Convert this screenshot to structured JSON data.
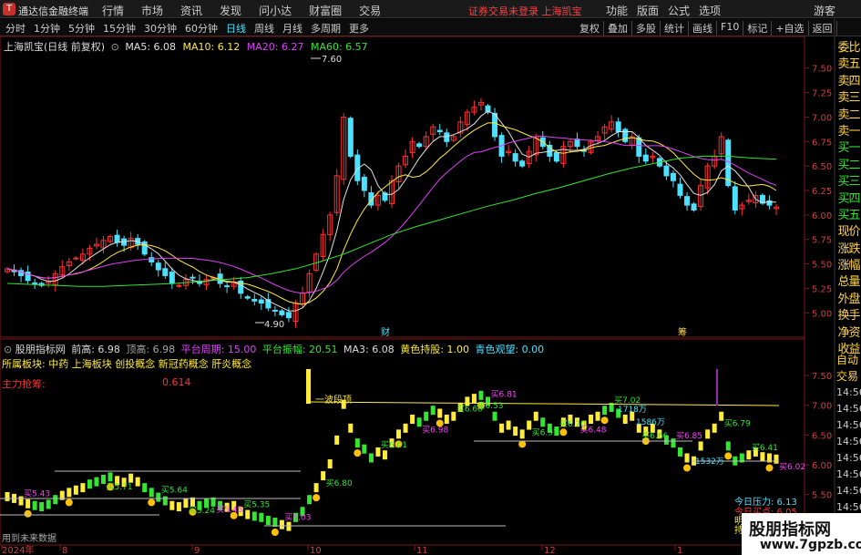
{
  "titlebar": {
    "app_name": "通达信金融终端",
    "menu": [
      "行情",
      "市场",
      "资讯",
      "发现",
      "问小达",
      "财富圈",
      "交易"
    ],
    "notice": "证券交易未登录  上海凯宝",
    "right_menu": [
      "功能",
      "版面",
      "公式",
      "选项"
    ],
    "guest": "游客"
  },
  "toolbar": {
    "periods": [
      "分时",
      "1分钟",
      "5分钟",
      "15分钟",
      "30分钟",
      "60分钟",
      "日线",
      "周线",
      "月线",
      "多周期",
      "更多"
    ],
    "active_period": "日线",
    "tools": [
      "复权",
      "叠加",
      "多股",
      "统计",
      "画线",
      "F10",
      "标记",
      "+自选",
      "返回"
    ]
  },
  "main_header": {
    "stock": "上海凯宝(日线 前复权)",
    "ma5_label": "MA5: 6.08",
    "ma10_label": "MA10: 6.12",
    "ma20_label": "MA20: 6.27",
    "ma60_label": "MA60: 6.57"
  },
  "sub_header": {
    "indicator": "股朋指标网",
    "prev_high": "前高: 6.98",
    "top_high": "顶高: 6.98",
    "cycle": "平台周期: 15.00",
    "amplitude": "平台振幅: 20.51",
    "ma3": "MA3: 6.08",
    "yellow_hold": "黄色持股: 1.00",
    "cyan_watch": "青色观望: 0.00"
  },
  "sectors": "所属板块: 中药 上海板块 创投概念 新冠药概念 肝炎概念",
  "main_force": {
    "label": "主力抢筹:",
    "value": "0.614"
  },
  "sidebar": {
    "items": [
      "委比",
      "卖五",
      "卖四",
      "卖三",
      "卖二",
      "卖一",
      "买一",
      "买二",
      "买三",
      "买四",
      "买五",
      "现价",
      "涨跌",
      "涨幅",
      "总量",
      "外盘",
      "换手",
      "净资",
      "收益"
    ],
    "bottom": [
      "自动",
      "交易",
      "14:56",
      "14:56",
      "14:56",
      "14:56",
      "14:56",
      "14:56",
      "14:56",
      "14:56",
      "14:56",
      "14:56"
    ]
  },
  "main_axis": [
    "7.50",
    "7.25",
    "7.00",
    "6.75",
    "6.50",
    "6.25",
    "6.00",
    "5.75",
    "5.50",
    "5.25",
    "5.00"
  ],
  "sub_axis": [
    "7.50",
    "7.00",
    "6.50",
    "6.00",
    "5.50"
  ],
  "date_axis": [
    "2024年",
    "8",
    "9",
    "10",
    "11",
    "12",
    "1"
  ],
  "chart_markers": {
    "high": "7.60",
    "low": "4.90",
    "cai": "财",
    "chou": "筹"
  },
  "sub_annotations": {
    "wave_top": "一波段顶",
    "today_pressure": "今日压力: 6.13",
    "today_buy": "今日买点: 6.05",
    "tomorrow": "明日",
    "hold": "持仓",
    "future_data": "用到未来数据",
    "buy_labels": [
      "买5.43",
      "买5.71",
      "买5.64",
      "买5.45",
      "买5.35",
      "买5.24",
      "买5.03",
      "买6.80",
      "买6.01",
      "买6.98",
      "买6.60",
      "买6.53",
      "买6.81",
      "买6.97",
      "买6.70",
      "买6.48",
      "买7.02",
      "买6.66",
      "买6.85",
      "买6.79",
      "买6.41",
      "买6.02"
    ],
    "vol_labels": [
      "1718万",
      "1532万",
      "1586万"
    ]
  },
  "watermark": {
    "line1": "股朋指标网",
    "line2": "www.7gpzb.com"
  },
  "chart_data": {
    "type": "candlestick",
    "ylim": [
      4.85,
      7.65
    ],
    "high_marker": 7.6,
    "low_marker": 4.9,
    "ma_latest": {
      "MA5": 6.08,
      "MA10": 6.12,
      "MA20": 6.27,
      "MA60": 6.57
    },
    "colors": {
      "up": "#ff3030",
      "down": "#4ee0ff",
      "ma5": "#e0e0e0",
      "ma10": "#ffeb3b",
      "ma20": "#e040fb",
      "ma60": "#32e632"
    },
    "closes": [
      5.45,
      5.42,
      5.38,
      5.33,
      5.3,
      5.28,
      5.32,
      5.4,
      5.47,
      5.52,
      5.56,
      5.6,
      5.66,
      5.7,
      5.74,
      5.78,
      5.72,
      5.69,
      5.76,
      5.7,
      5.6,
      5.52,
      5.44,
      5.38,
      5.3,
      5.28,
      5.34,
      5.36,
      5.3,
      5.34,
      5.36,
      5.3,
      5.27,
      5.3,
      5.2,
      5.15,
      5.12,
      5.1,
      5.05,
      5.02,
      4.98,
      4.95,
      5.1,
      5.2,
      5.4,
      5.6,
      5.8,
      6.0,
      6.4,
      7.0,
      6.6,
      6.35,
      6.25,
      6.1,
      6.2,
      6.15,
      6.35,
      6.5,
      6.6,
      6.75,
      6.7,
      6.8,
      6.9,
      6.85,
      6.75,
      6.8,
      6.95,
      7.05,
      7.1,
      7.15,
      7.05,
      6.8,
      6.6,
      6.65,
      6.55,
      6.5,
      6.65,
      6.8,
      6.7,
      6.6,
      6.55,
      6.7,
      6.75,
      6.7,
      6.65,
      6.75,
      6.8,
      6.9,
      6.95,
      6.85,
      6.75,
      6.8,
      6.6,
      6.55,
      6.6,
      6.5,
      6.4,
      6.35,
      6.2,
      6.1,
      6.05,
      6.3,
      6.5,
      6.6,
      6.8,
      6.3,
      6.05,
      6.1,
      6.15,
      6.2,
      6.12,
      6.1,
      6.08
    ],
    "ma60": [
      5.3,
      5.29,
      5.28,
      5.27,
      5.27,
      5.28,
      5.29,
      5.3,
      5.32,
      5.34,
      5.36,
      5.4,
      5.45,
      5.52,
      5.6,
      5.7,
      5.8,
      5.88,
      5.95,
      6.02,
      6.09,
      6.15,
      6.22,
      6.28,
      6.35,
      6.42,
      6.48,
      6.53,
      6.58,
      6.6,
      6.6,
      6.58,
      6.57
    ]
  }
}
